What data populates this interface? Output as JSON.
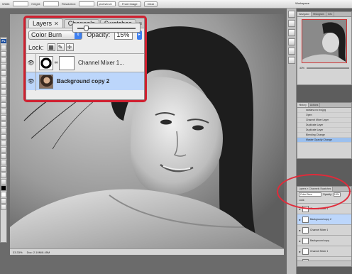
{
  "options_bar": {
    "width_label": "Width:",
    "height_label": "Height:",
    "resolution_label": "Resolution:",
    "units_value": "pixels/inch",
    "front_image_label": "Front Image",
    "clear_label": "Clear",
    "workspace_label": "Workspace"
  },
  "toolbox": {
    "logo": "Ps"
  },
  "status_bar": {
    "zoom": "33.33%",
    "doc": "Doc: 2.10M/8.45M"
  },
  "navigator": {
    "tabs": [
      "Navigator",
      "Histogram",
      "Info"
    ],
    "zoom_value": "33%"
  },
  "history": {
    "tabs": [
      "History",
      "Actions"
    ],
    "items": [
      {
        "label": "santana no bw.jpg",
        "selected": false
      },
      {
        "label": "Open",
        "selected": false
      },
      {
        "label": "Channel Mixer Layer",
        "selected": false
      },
      {
        "label": "Duplicate Layer",
        "selected": false
      },
      {
        "label": "Duplicate Layer",
        "selected": false
      },
      {
        "label": "Blending Change",
        "selected": false
      },
      {
        "label": "Master Opacity Change",
        "selected": true
      }
    ]
  },
  "layers_panel": {
    "tabs": [
      {
        "label": "Layers",
        "active": true,
        "closable": true
      },
      {
        "label": "Channels",
        "active": false,
        "closable": false
      },
      {
        "label": "Swatches",
        "active": false,
        "closable": false
      }
    ],
    "blend_mode": "Color Burn",
    "opacity_label": "Opacity:",
    "opacity_value": "15%",
    "opacity_fraction": 0.15,
    "lock_label": "Lock:",
    "lock_icons": [
      "lock-transparent-icon",
      "lock-paint-icon",
      "lock-move-icon"
    ],
    "layers": [
      {
        "name": "Channel Mixer 1...",
        "selected": false,
        "bold": false
      },
      {
        "name": "Background copy 2",
        "selected": true,
        "bold": true
      }
    ]
  },
  "small_layers": {
    "tabs": "Layers × Channels Swatches",
    "blend_mode": "Color Burn",
    "opacity_label": "Opacity:",
    "opacity_value": "15%",
    "lock_label": "Lock:",
    "layers": [
      {
        "name": "Channel Mixer 1",
        "selected": false
      },
      {
        "name": "Background copy 2",
        "selected": true
      },
      {
        "name": "Channel Mixer 1",
        "selected": false
      },
      {
        "name": "Background copy",
        "selected": false
      },
      {
        "name": "Channel Mixer 1",
        "selected": false
      },
      {
        "name": "Background",
        "selected": false
      }
    ]
  },
  "colors": {
    "highlight_ring": "#d02030",
    "selected_layer": "#bcd6fb",
    "accent_blue": "#3d7ff0"
  }
}
